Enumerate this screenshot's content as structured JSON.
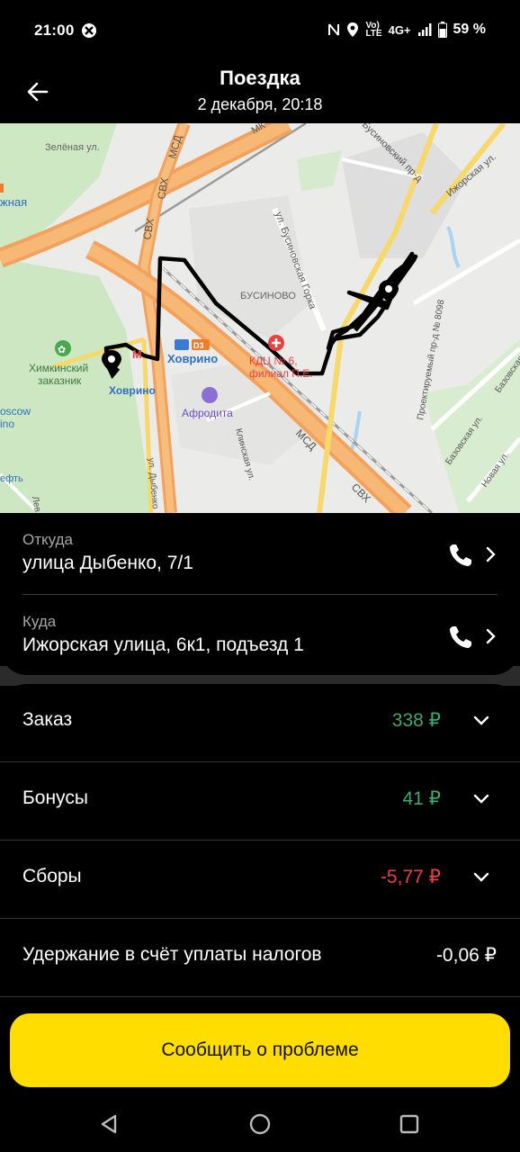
{
  "status_bar": {
    "time": "21:00",
    "network": "4G+",
    "volte_top": "Vo)",
    "volte_bottom": "LTE",
    "battery": "59 %"
  },
  "header": {
    "title": "Поездка",
    "subtitle": "2 декабря, 20:18"
  },
  "map": {
    "labels": {
      "zelenaya": "Зелёная ул.",
      "yuzhnaya": "жная",
      "svh1": "СВХ",
      "svh2": "СВХ",
      "mcd_top": "МСД",
      "mkad": "МК",
      "busin_proezd": "Бусиновский пр-д",
      "izhorskaya": "Ижорская ул.",
      "busin_gorka": "ул. Бусиновская Горка",
      "businovo": "БУСИНОВО",
      "hovrino_station": "Ховрино",
      "d3": "D3",
      "kdc1": "КДЦ № 6,",
      "kdc2": "филиал П.Е.",
      "khimki1": "Химкинский",
      "khimki2": "заказник",
      "hovrino_metro": "Ховрино",
      "moscow": "oscow",
      "ino": "ino",
      "afrodita": "Афродита",
      "proektiruemy": "Проектируемый пр-д № 8098",
      "bazovskaya1": "Базовская ул.",
      "bazovskaya2": "Базовская ул.",
      "novaya": "Новая ул.",
      "klinskaya": "Клинская ул.",
      "dybenko": "ул. Дыбенко",
      "mcd_bottom": "МСД",
      "svh_bottom": "СВХ",
      "left1": "ефть",
      "left2": "Лев"
    }
  },
  "trip": {
    "from_label": "Откуда",
    "from_value": "улица Дыбенко, 7/1",
    "to_label": "Куда",
    "to_value": "Ижорская улица, 6к1, подъезд 1"
  },
  "payments": {
    "order_label": "Заказ",
    "order_value": "338 ₽",
    "bonus_label": "Бонусы",
    "bonus_value": "41 ₽",
    "fees_label": "Сборы",
    "fees_value": "-5,77 ₽",
    "tax_label": "Удержание в счёт уплаты налогов",
    "tax_value": "-0,06 ₽"
  },
  "actions": {
    "report_label": "Сообщить о проблеме"
  },
  "colors": {
    "positive": "#3fa86b",
    "negative": "#e8423f",
    "button": "#ffdd00"
  }
}
